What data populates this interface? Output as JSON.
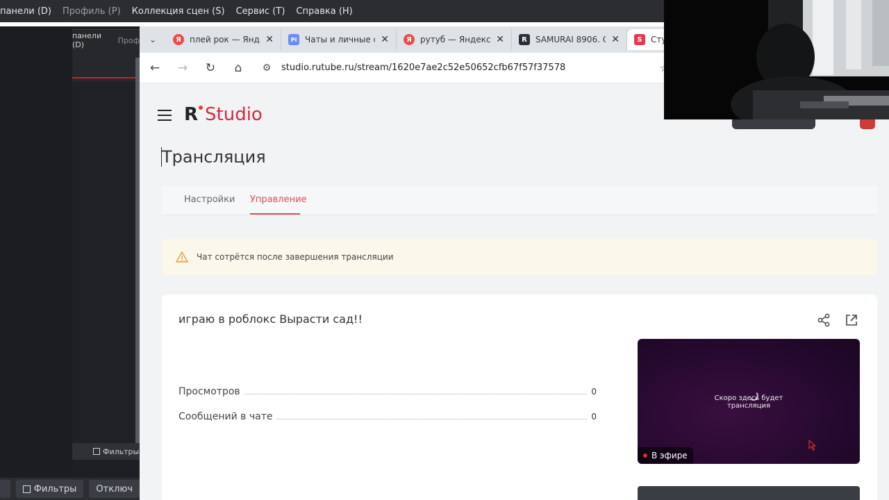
{
  "menubar": {
    "items": [
      "панели (D)",
      "Профиль (P)",
      "Коллекция сцен (S)",
      "Сервис (T)",
      "Справка (H)"
    ]
  },
  "obs": {
    "panel_header": "панели (D)",
    "panel_header_dim": "Проф",
    "filters_small": "Фильтры",
    "filters_bottom": "Фильтры",
    "disable_bottom": "Отключ"
  },
  "browser": {
    "tabs": [
      {
        "title": "плей рок — Яндекс",
        "icon": "Я",
        "color": "#ee4b46"
      },
      {
        "title": "Чаты и личные со",
        "icon": "PI",
        "color": "#6b8cff"
      },
      {
        "title": "рутуб — Яндекс",
        "icon": "Я",
        "color": "#ee4b46"
      },
      {
        "title": "SAMURAI 8906. С",
        "icon": "R",
        "color": "#2c2f36"
      },
      {
        "title": "Сту",
        "icon": "S",
        "color": "#e23b4b"
      }
    ],
    "url": "studio.rutube.ru/stream/1620e7ae2c52e50652cfb67f57f37578"
  },
  "page": {
    "logo_r": "R",
    "logo_studio": "Studio",
    "title": "Трансляция",
    "tabs": {
      "settings": "Настройки",
      "control": "Управление"
    },
    "warning": "Чат сотрётся после завершения трансляции",
    "stream_title": "играю в роблокс Вырасти сад!!",
    "stats": [
      {
        "label": "Просмотров",
        "value": "0"
      },
      {
        "label": "Сообщений в чате",
        "value": "0"
      }
    ],
    "preview_message_line1": "Скоро здесь будет",
    "preview_message_line2": "трансляция",
    "live_label": "В эфире"
  },
  "colors": {
    "accent": "#d6293b",
    "tab_active": "#e04b55",
    "warning_bg": "#fbf7ea",
    "preview_bg": "#2a0a33"
  }
}
